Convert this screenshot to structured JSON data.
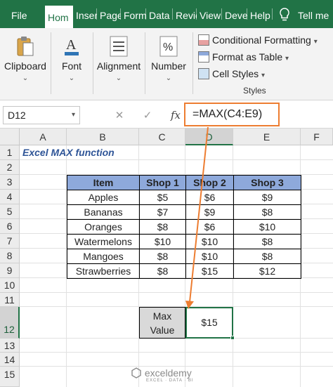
{
  "tabs": [
    {
      "label": "File"
    },
    {
      "label": "Hom"
    },
    {
      "label": "Inser"
    },
    {
      "label": "Page"
    },
    {
      "label": "Form"
    },
    {
      "label": "Data"
    },
    {
      "label": "Revie"
    },
    {
      "label": "View"
    },
    {
      "label": "Deve"
    },
    {
      "label": "Help"
    },
    {
      "label": "Tell me"
    }
  ],
  "ribbon": {
    "clipboard": "Clipboard",
    "font": "Font",
    "alignment": "Alignment",
    "number": "Number",
    "conditional_formatting": "Conditional Formatting",
    "format_as_table": "Format as Table",
    "cell_styles": "Cell Styles",
    "styles_group": "Styles"
  },
  "formula_bar": {
    "name_box": "D12",
    "formula": "=MAX(C4:E9)",
    "cancel_icon": "✕",
    "enter_icon": "✓",
    "fx_label": "fx"
  },
  "columns": [
    "A",
    "B",
    "C",
    "D",
    "E",
    "F"
  ],
  "rows": [
    "1",
    "2",
    "3",
    "4",
    "5",
    "6",
    "7",
    "8",
    "9",
    "10",
    "11",
    "12",
    "13",
    "14",
    "15"
  ],
  "sheet": {
    "title": "Excel MAX function",
    "headers": [
      "Item",
      "Shop 1",
      "Shop 2",
      "Shop 3"
    ],
    "rows": [
      {
        "item": "Apples",
        "shop1": "$5",
        "shop2": "$6",
        "shop3": "$9"
      },
      {
        "item": "Bananas",
        "shop1": "$7",
        "shop2": "$9",
        "shop3": "$8"
      },
      {
        "item": "Oranges",
        "shop1": "$8",
        "shop2": "$6",
        "shop3": "$10"
      },
      {
        "item": "Watermelons",
        "shop1": "$10",
        "shop2": "$10",
        "shop3": "$8"
      },
      {
        "item": "Mangoes",
        "shop1": "$8",
        "shop2": "$10",
        "shop3": "$8"
      },
      {
        "item": "Strawberries",
        "shop1": "$8",
        "shop2": "$15",
        "shop3": "$12"
      }
    ],
    "max_label_line1": "Max",
    "max_label_line2": "Value",
    "max_value": "$15"
  },
  "watermark": {
    "text": "exceldemy",
    "sub": "EXCEL · DATA · BI"
  },
  "colors": {
    "ribbon_green": "#217346",
    "header_blue": "#8ea9db",
    "arrow_orange": "#ed7d31"
  }
}
